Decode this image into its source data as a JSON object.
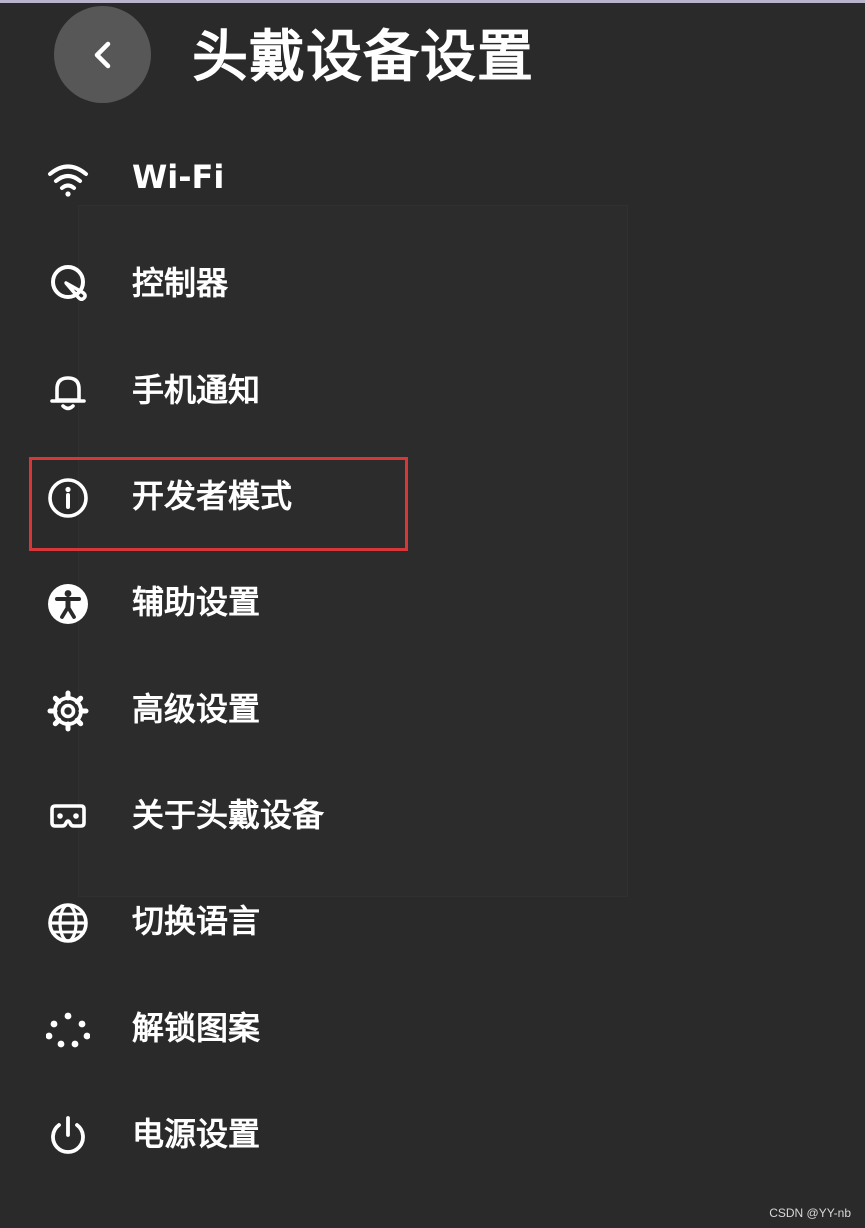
{
  "header": {
    "title": "头戴设备设置",
    "back_icon": "chevron-left-icon"
  },
  "menu": {
    "items": [
      {
        "label": "Wi-Fi",
        "icon": "wifi-icon"
      },
      {
        "label": "控制器",
        "icon": "controller-icon"
      },
      {
        "label": "手机通知",
        "icon": "bell-icon"
      },
      {
        "label": "开发者模式",
        "icon": "info-icon",
        "highlighted": true
      },
      {
        "label": "辅助设置",
        "icon": "accessibility-icon"
      },
      {
        "label": "高级设置",
        "icon": "gear-icon"
      },
      {
        "label": "关于头戴设备",
        "icon": "headset-icon"
      },
      {
        "label": "切换语言",
        "icon": "globe-icon"
      },
      {
        "label": "解锁图案",
        "icon": "dot-pattern-icon"
      },
      {
        "label": "电源设置",
        "icon": "power-icon"
      }
    ]
  },
  "colors": {
    "background": "#2a2a2a",
    "back_button": "#575757",
    "text": "#ffffff",
    "highlight": "#d8373a"
  },
  "watermark": "CSDN @YY-nb"
}
